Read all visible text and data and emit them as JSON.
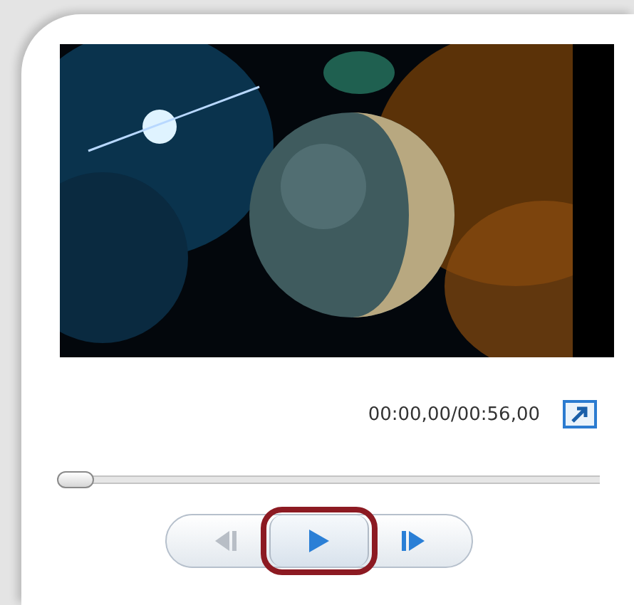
{
  "time": "00:00,00/00:56,00",
  "seek": {
    "level": 0
  },
  "controls": [
    {
      "kind": "previous",
      "highlighted": false
    },
    {
      "kind": "play",
      "highlighted": true
    },
    {
      "kind": "next",
      "highlighted": false
    }
  ]
}
